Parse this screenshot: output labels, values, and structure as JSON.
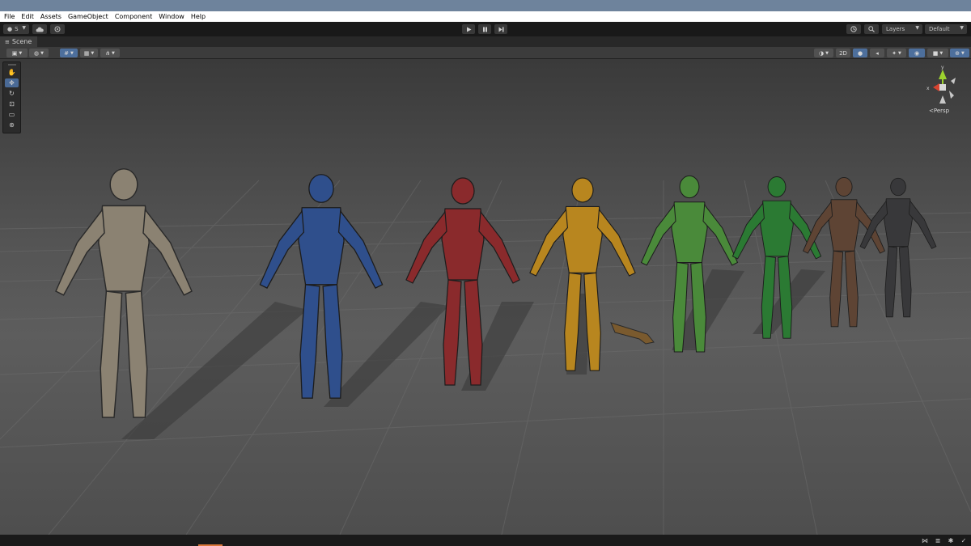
{
  "menu": [
    "File",
    "Edit",
    "Assets",
    "GameObject",
    "Component",
    "Window",
    "Help"
  ],
  "toolbar": {
    "account_label": "S",
    "layers_label": "Layers",
    "layout_label": "Default",
    "play_icon": "play-icon",
    "pause_icon": "pause-icon",
    "step_icon": "step-icon"
  },
  "scene_tab": {
    "label": "Scene"
  },
  "scene_toolbar": {
    "mode_2d_label": "2D"
  },
  "gizmo": {
    "persp_label": "<Persp",
    "axis_y": "y",
    "axis_x": "x",
    "colors": {
      "y": "#9cd22e",
      "x": "#d8432f",
      "z": "#4a78c8"
    }
  },
  "tools": [
    "hand-tool",
    "move-tool",
    "rotate-tool",
    "scale-tool",
    "rect-tool",
    "transform-tool"
  ],
  "characters": [
    {
      "name": "beige-armor",
      "color": "#8b8272"
    },
    {
      "name": "blue-armor",
      "color": "#2f4f8c"
    },
    {
      "name": "red-armor",
      "color": "#8a2a2c"
    },
    {
      "name": "yellow-armor",
      "color": "#b8861f"
    },
    {
      "name": "lime-armor",
      "color": "#4a8a3a"
    },
    {
      "name": "green-armor",
      "color": "#2b7a33"
    },
    {
      "name": "brown-armor",
      "color": "#5e4434"
    },
    {
      "name": "black-armor",
      "color": "#38383a"
    }
  ]
}
